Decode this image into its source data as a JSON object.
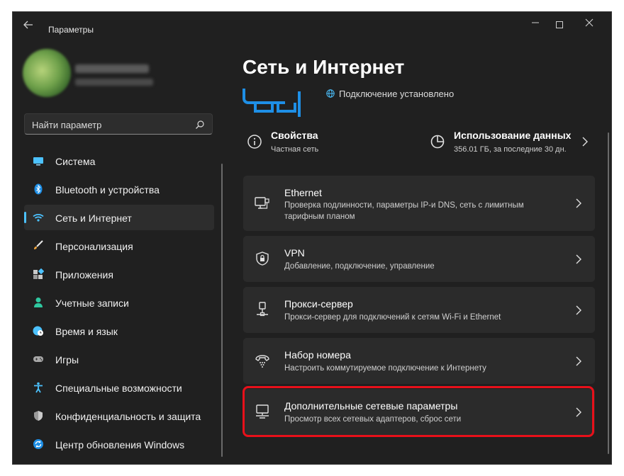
{
  "window": {
    "title": "Параметры"
  },
  "sidebar": {
    "search": {
      "placeholder": "Найти параметр"
    },
    "items": [
      {
        "label": "Система",
        "icon": "monitor-icon",
        "active": false
      },
      {
        "label": "Bluetooth и устройства",
        "icon": "bluetooth-icon",
        "active": false
      },
      {
        "label": "Сеть и Интернет",
        "icon": "wifi-icon",
        "active": true
      },
      {
        "label": "Персонализация",
        "icon": "brush-icon",
        "active": false
      },
      {
        "label": "Приложения",
        "icon": "apps-icon",
        "active": false
      },
      {
        "label": "Учетные записи",
        "icon": "person-icon",
        "active": false
      },
      {
        "label": "Время и язык",
        "icon": "globe-clock-icon",
        "active": false
      },
      {
        "label": "Игры",
        "icon": "gamepad-icon",
        "active": false
      },
      {
        "label": "Специальные возможности",
        "icon": "accessibility-icon",
        "active": false
      },
      {
        "label": "Конфиденциальность и защита",
        "icon": "shield-icon",
        "active": false
      },
      {
        "label": "Центр обновления Windows",
        "icon": "update-icon",
        "active": false
      }
    ]
  },
  "main": {
    "title": "Сеть и Интернет",
    "status": "Подключение установлено",
    "properties": {
      "title": "Свойства",
      "subtitle": "Частная сеть"
    },
    "data_usage": {
      "title": "Использование данных",
      "subtitle": "356.01 ГБ, за последние 30 дн."
    },
    "cards": [
      {
        "title": "Ethernet",
        "subtitle": "Проверка подлинности, параметры IP-и DNS, сеть с лимитным тарифным планом",
        "icon": "ethernet-icon"
      },
      {
        "title": "VPN",
        "subtitle": "Добавление, подключение, управление",
        "icon": "vpn-shield-icon"
      },
      {
        "title": "Прокси-сервер",
        "subtitle": "Прокси-сервер для подключений к сетям Wi-Fi и Ethernet",
        "icon": "proxy-icon"
      },
      {
        "title": "Набор номера",
        "subtitle": "Настроить коммутируемое подключение к Интернету",
        "icon": "dialup-icon"
      },
      {
        "title": "Дополнительные сетевые параметры",
        "subtitle": "Просмотр всех сетевых адаптеров, сброс сети",
        "icon": "network-adapter-icon",
        "highlighted": true
      }
    ]
  },
  "colors": {
    "accent": "#4cc2ff",
    "highlight": "#e8101a",
    "background": "#202020",
    "card": "#2b2b2b"
  }
}
